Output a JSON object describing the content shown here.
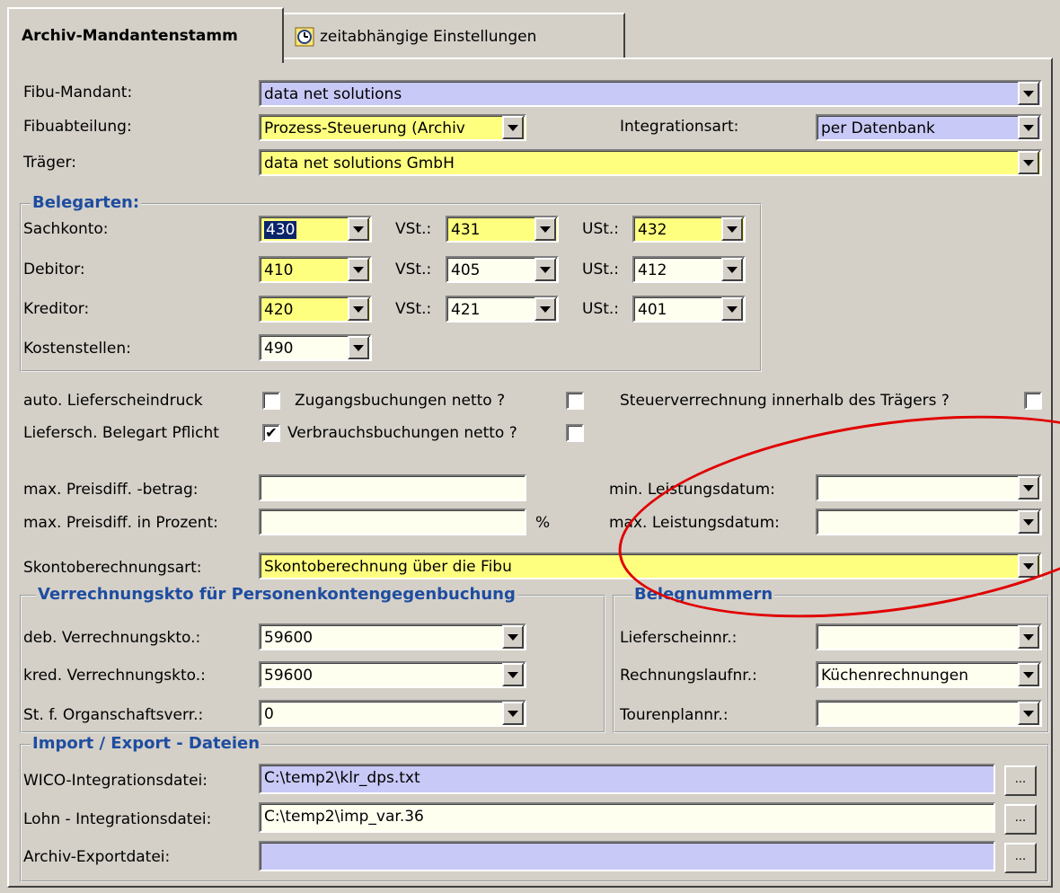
{
  "tabs": [
    {
      "label": "Archiv-Mandantenstamm",
      "active": true
    },
    {
      "label": "zeitabhängige Einstellungen",
      "icon": "clock-settings-icon",
      "active": false
    }
  ],
  "top": {
    "fibu_mandant": {
      "label": "Fibu-Mandant:",
      "value": "data net solutions"
    },
    "fibuabteilung": {
      "label": "Fibuabteilung:",
      "value": "Prozess-Steuerung (Archiv"
    },
    "integrationsart": {
      "label": "Integrationsart:",
      "value": "per Datenbank"
    },
    "traeger": {
      "label": "Träger:",
      "value": "data net solutions GmbH"
    }
  },
  "belegarten": {
    "legend": "Belegarten:",
    "vst_label": "VSt.:",
    "ust_label": "USt.:",
    "rows": [
      {
        "label": "Sachkonto:",
        "value": "430",
        "vst": "431",
        "ust": "432"
      },
      {
        "label": "Debitor:",
        "value": "410",
        "vst": "405",
        "ust": "412"
      },
      {
        "label": "Kreditor:",
        "value": "420",
        "vst": "421",
        "ust": "401"
      },
      {
        "label": "Kostenstellen:",
        "value": "490"
      }
    ]
  },
  "options": {
    "auto_lieferscheindruck": {
      "label": "auto. Lieferscheindruck",
      "checked": false
    },
    "zugangsbuchungen": {
      "label": "Zugangsbuchungen netto ?",
      "checked": false
    },
    "steuerverrechnung": {
      "label": "Steuerverrechnung innerhalb des Trägers ?",
      "checked": false
    },
    "liefersch_pflicht": {
      "label": "Liefersch. Belegart Pflicht",
      "checked": true
    },
    "verbrauchsbuchungen": {
      "label": "Verbrauchsbuchungen netto ?",
      "checked": false
    },
    "check_mark": "✔"
  },
  "preis": {
    "max_betrag": {
      "label": "max. Preisdiff. -betrag:",
      "value": ""
    },
    "max_prozent": {
      "label": "max. Preisdiff. in Prozent:",
      "value": "",
      "unit": "%"
    },
    "min_leistungsdatum": {
      "label": "min. Leistungsdatum:",
      "value": ""
    },
    "max_leistungsdatum": {
      "label": "max. Leistungsdatum:",
      "value": ""
    }
  },
  "skonto": {
    "label": "Skontoberechnungsart:",
    "value": "Skontoberechnung über die Fibu"
  },
  "verrechnung": {
    "legend": "Verrechnungskto für Personenkontengegenbuchung",
    "rows": [
      {
        "label": "deb. Verrechnungskto.:",
        "value": "59600"
      },
      {
        "label": "kred. Verrechnungskto.:",
        "value": "59600"
      },
      {
        "label": "St. f. Organschaftsverr.:",
        "value": "0"
      }
    ]
  },
  "belegnummern": {
    "legend": "Belegnummern",
    "rows": [
      {
        "label": "Lieferscheinnr.:",
        "value": ""
      },
      {
        "label": "Rechnungslaufnr.:",
        "value": "Küchenrechnungen"
      },
      {
        "label": "Tourenplannr.:",
        "value": ""
      }
    ]
  },
  "dateien": {
    "legend": "Import / Export - Dateien",
    "browse_label": "...",
    "rows": [
      {
        "label": "WICO-Integrationsdatei:",
        "value": "C:\\temp2\\klr_dps.txt"
      },
      {
        "label": "Lohn - Integrationsdatei:",
        "value": "C:\\temp2\\imp_var.36"
      },
      {
        "label": "Archiv-Exportdatei:",
        "value": ""
      }
    ]
  },
  "colors": {
    "yellow_field": "#ffff7f",
    "blue_field": "#c9c9f7",
    "cream_field": "#fffff0",
    "legend_blue": "#1e4da0",
    "annotation_red": "#e00000"
  }
}
